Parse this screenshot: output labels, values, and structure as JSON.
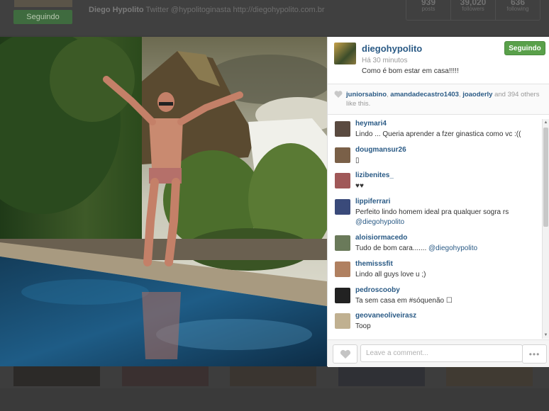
{
  "background_profile": {
    "follow_label": "Seguindo",
    "name": "Diego Hypolito",
    "bio": "Twitter @hypolitoginasta http://diegohypolito.com.br",
    "stats": [
      {
        "num": "939",
        "label": "posts"
      },
      {
        "num": "39,020",
        "label": "followers"
      },
      {
        "num": "636",
        "label": "following"
      }
    ]
  },
  "post": {
    "username": "diegohypolito",
    "time": "Há 30 minutos",
    "caption": "Como é bom estar em casa!!!!!",
    "follow_label": "Seguindo",
    "likes": {
      "users": [
        "juniorsabino",
        "amandadecastro1403",
        "joaoderly"
      ],
      "separator": ", ",
      "and_text": " and 394 others like this."
    }
  },
  "comments": [
    {
      "user": "heymari4",
      "text": "Lindo ... Queria aprender a fzer ginastica como vc :((",
      "avatar_color": "#5a4a40"
    },
    {
      "user": "dougmansur26",
      "text": "▯",
      "avatar_color": "#7a6048"
    },
    {
      "user": "lizibenites_",
      "text": "♥♥",
      "avatar_color": "#a05858"
    },
    {
      "user": "lippiferrari",
      "text": "Perfeito lindo homem ideal pra qualquer sogra rs",
      "mention": "@diegohypolito",
      "avatar_color": "#3a4a7a"
    },
    {
      "user": "aloisiormacedo",
      "text": "Tudo de bom cara....... ",
      "mention": "@diegohypolito",
      "avatar_color": "#6a7a5a"
    },
    {
      "user": "themisssfit",
      "text": "Lindo all guys love u ;)",
      "avatar_color": "#b08060"
    },
    {
      "user": "pedroscooby",
      "text": "Ta sem casa em #sóquenão ☐",
      "avatar_color": "#222222"
    },
    {
      "user": "geovaneoliveirasz",
      "text": "Toop",
      "avatar_color": "#c0b090"
    }
  ],
  "footer": {
    "comment_placeholder": "Leave a comment...",
    "more_label": "•••"
  },
  "colors": {
    "link": "#2a5a85",
    "follow_green": "#59a04a"
  }
}
